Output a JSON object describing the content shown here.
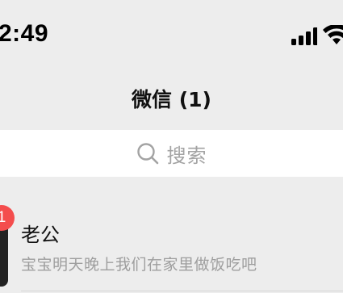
{
  "status_bar": {
    "time": "2:49",
    "signal_icon": "cellular-signal-icon",
    "wifi_icon": "wifi-icon"
  },
  "nav": {
    "title": "微信 (1)"
  },
  "search": {
    "placeholder": "搜索",
    "icon": "search-icon"
  },
  "chats": [
    {
      "name": "老公",
      "preview": "宝宝明天晚上我们在家里做饭吃吧",
      "unread": "1",
      "avatar_icon": "avatar"
    }
  ],
  "colors": {
    "background": "#ededed",
    "badge": "#f44d4d",
    "search_bg": "#ffffff",
    "preview_text": "#9e9e9e"
  }
}
